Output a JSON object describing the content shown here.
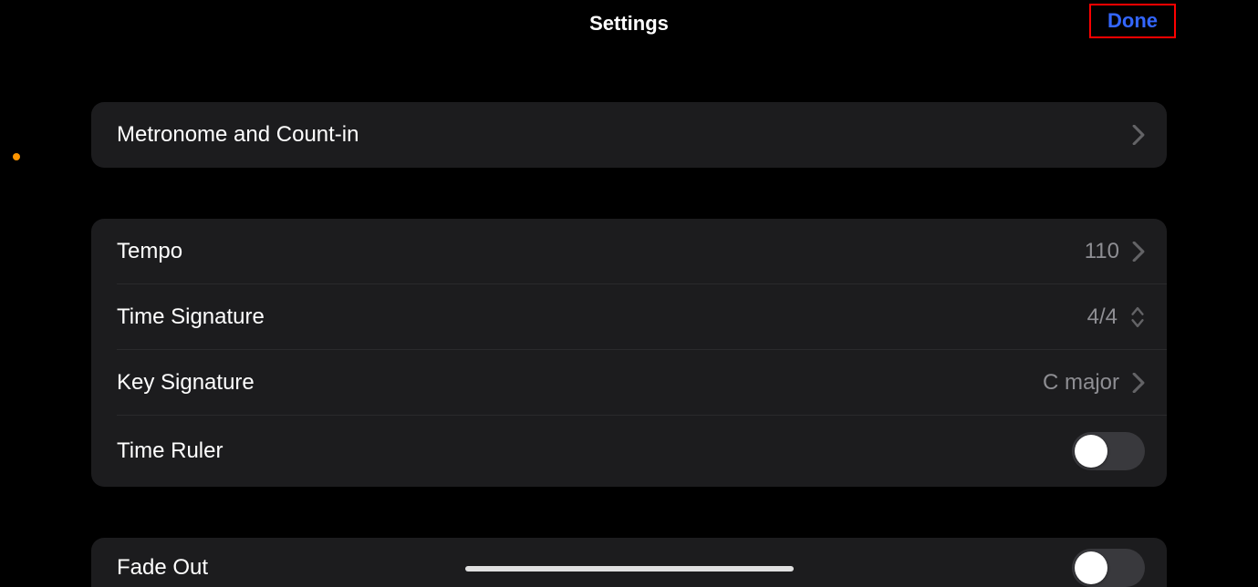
{
  "header": {
    "title": "Settings",
    "done_label": "Done"
  },
  "group1": {
    "metronome": {
      "label": "Metronome and Count-in"
    }
  },
  "group2": {
    "tempo": {
      "label": "Tempo",
      "value": "110"
    },
    "time_signature": {
      "label": "Time Signature",
      "value": "4/4"
    },
    "key_signature": {
      "label": "Key Signature",
      "value": "C major"
    },
    "time_ruler": {
      "label": "Time Ruler",
      "on": false
    }
  },
  "group3": {
    "fade_out": {
      "label": "Fade Out",
      "on": false
    }
  }
}
